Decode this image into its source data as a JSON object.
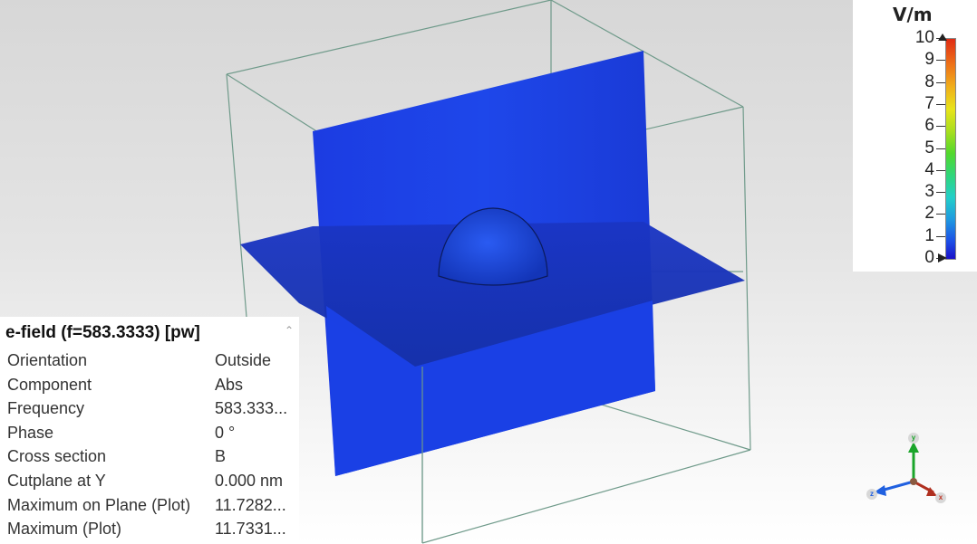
{
  "legend": {
    "unit": "V/m",
    "ticks": [
      "10",
      "9",
      "8",
      "7",
      "6",
      "5",
      "4",
      "3",
      "2",
      "1",
      "0"
    ]
  },
  "props": {
    "title": "e-field (f=583.3333) [pw]",
    "rows": [
      {
        "key": "Orientation",
        "value": "Outside"
      },
      {
        "key": "Component",
        "value": "Abs"
      },
      {
        "key": "Frequency",
        "value": "583.333..."
      },
      {
        "key": "Phase",
        "value": "0 °"
      },
      {
        "key": "Cross section",
        "value": "B"
      },
      {
        "key": "Cutplane at Y",
        "value": "0.000 nm"
      },
      {
        "key": "Maximum on Plane (Plot)",
        "value": "11.7282..."
      },
      {
        "key": "Maximum (Plot)",
        "value": "11.7331..."
      }
    ]
  },
  "axes": {
    "x": "x",
    "y": "y",
    "z": "z"
  },
  "colors": {
    "field_plane": "#1a3fe0",
    "box_edges": "#6f9a8a",
    "legend_max": "#e02c14",
    "legend_min": "#1a10c8"
  }
}
